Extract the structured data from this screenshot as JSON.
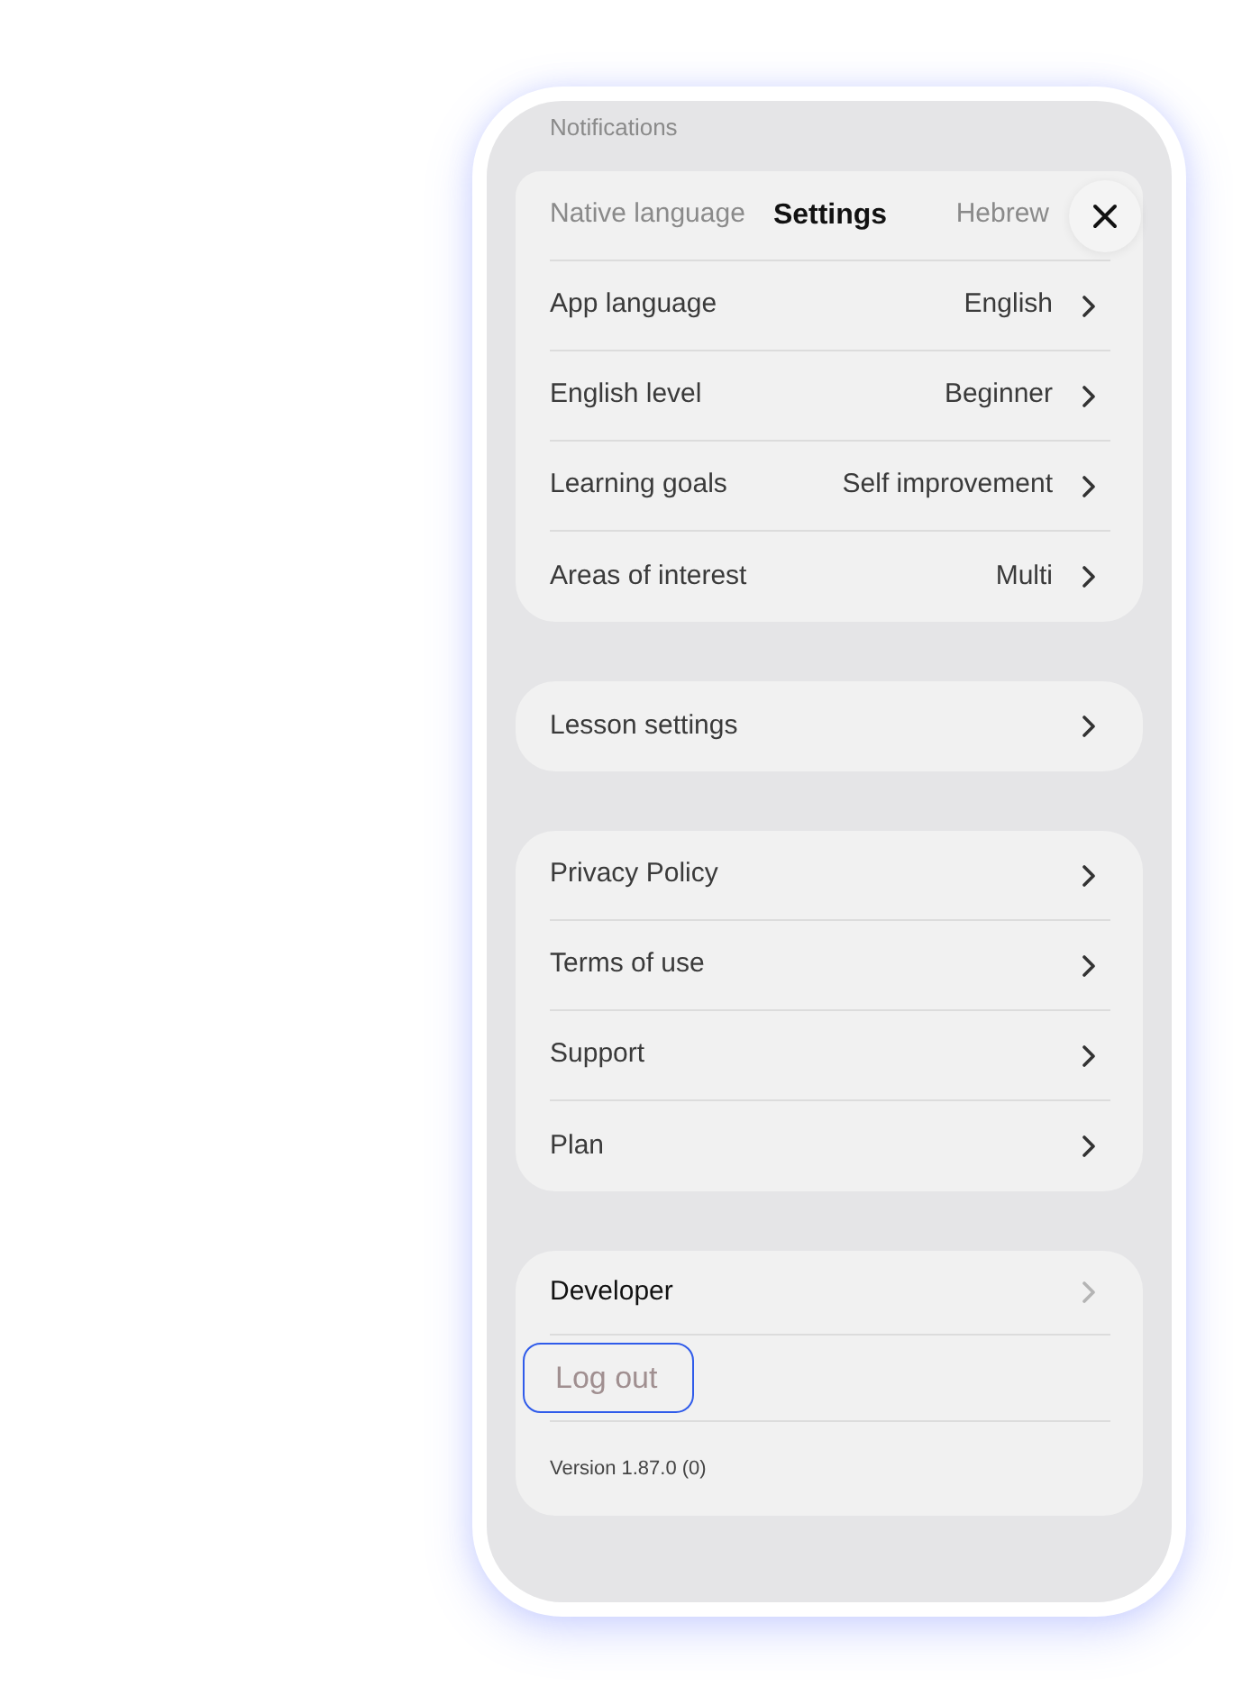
{
  "background": {
    "heading": "Notifications"
  },
  "header": {
    "title": "Settings",
    "row_behind": {
      "label": "Native language",
      "value": "Hebrew"
    }
  },
  "groups": [
    {
      "rows": [
        {
          "label": "App language",
          "value": "English",
          "kind": "nav"
        },
        {
          "label": "English level",
          "value": "Beginner",
          "kind": "nav"
        },
        {
          "label": "Learning goals",
          "value": "Self improvement",
          "kind": "nav"
        },
        {
          "label": "Areas of interest",
          "value": "Multi",
          "kind": "nav"
        }
      ]
    },
    {
      "rows": [
        {
          "label": "Lesson settings",
          "kind": "nav"
        }
      ]
    },
    {
      "rows": [
        {
          "label": "Privacy Policy",
          "kind": "nav"
        },
        {
          "label": "Terms of use",
          "kind": "nav"
        },
        {
          "label": "Support",
          "kind": "nav"
        },
        {
          "label": "Plan",
          "kind": "nav"
        }
      ]
    }
  ],
  "account": {
    "rows": [
      {
        "label": "Developer",
        "kind": "nav"
      },
      {
        "label": "Log out",
        "kind": "action",
        "focused": true
      }
    ],
    "version": "Version 1.87.0 (0)"
  }
}
